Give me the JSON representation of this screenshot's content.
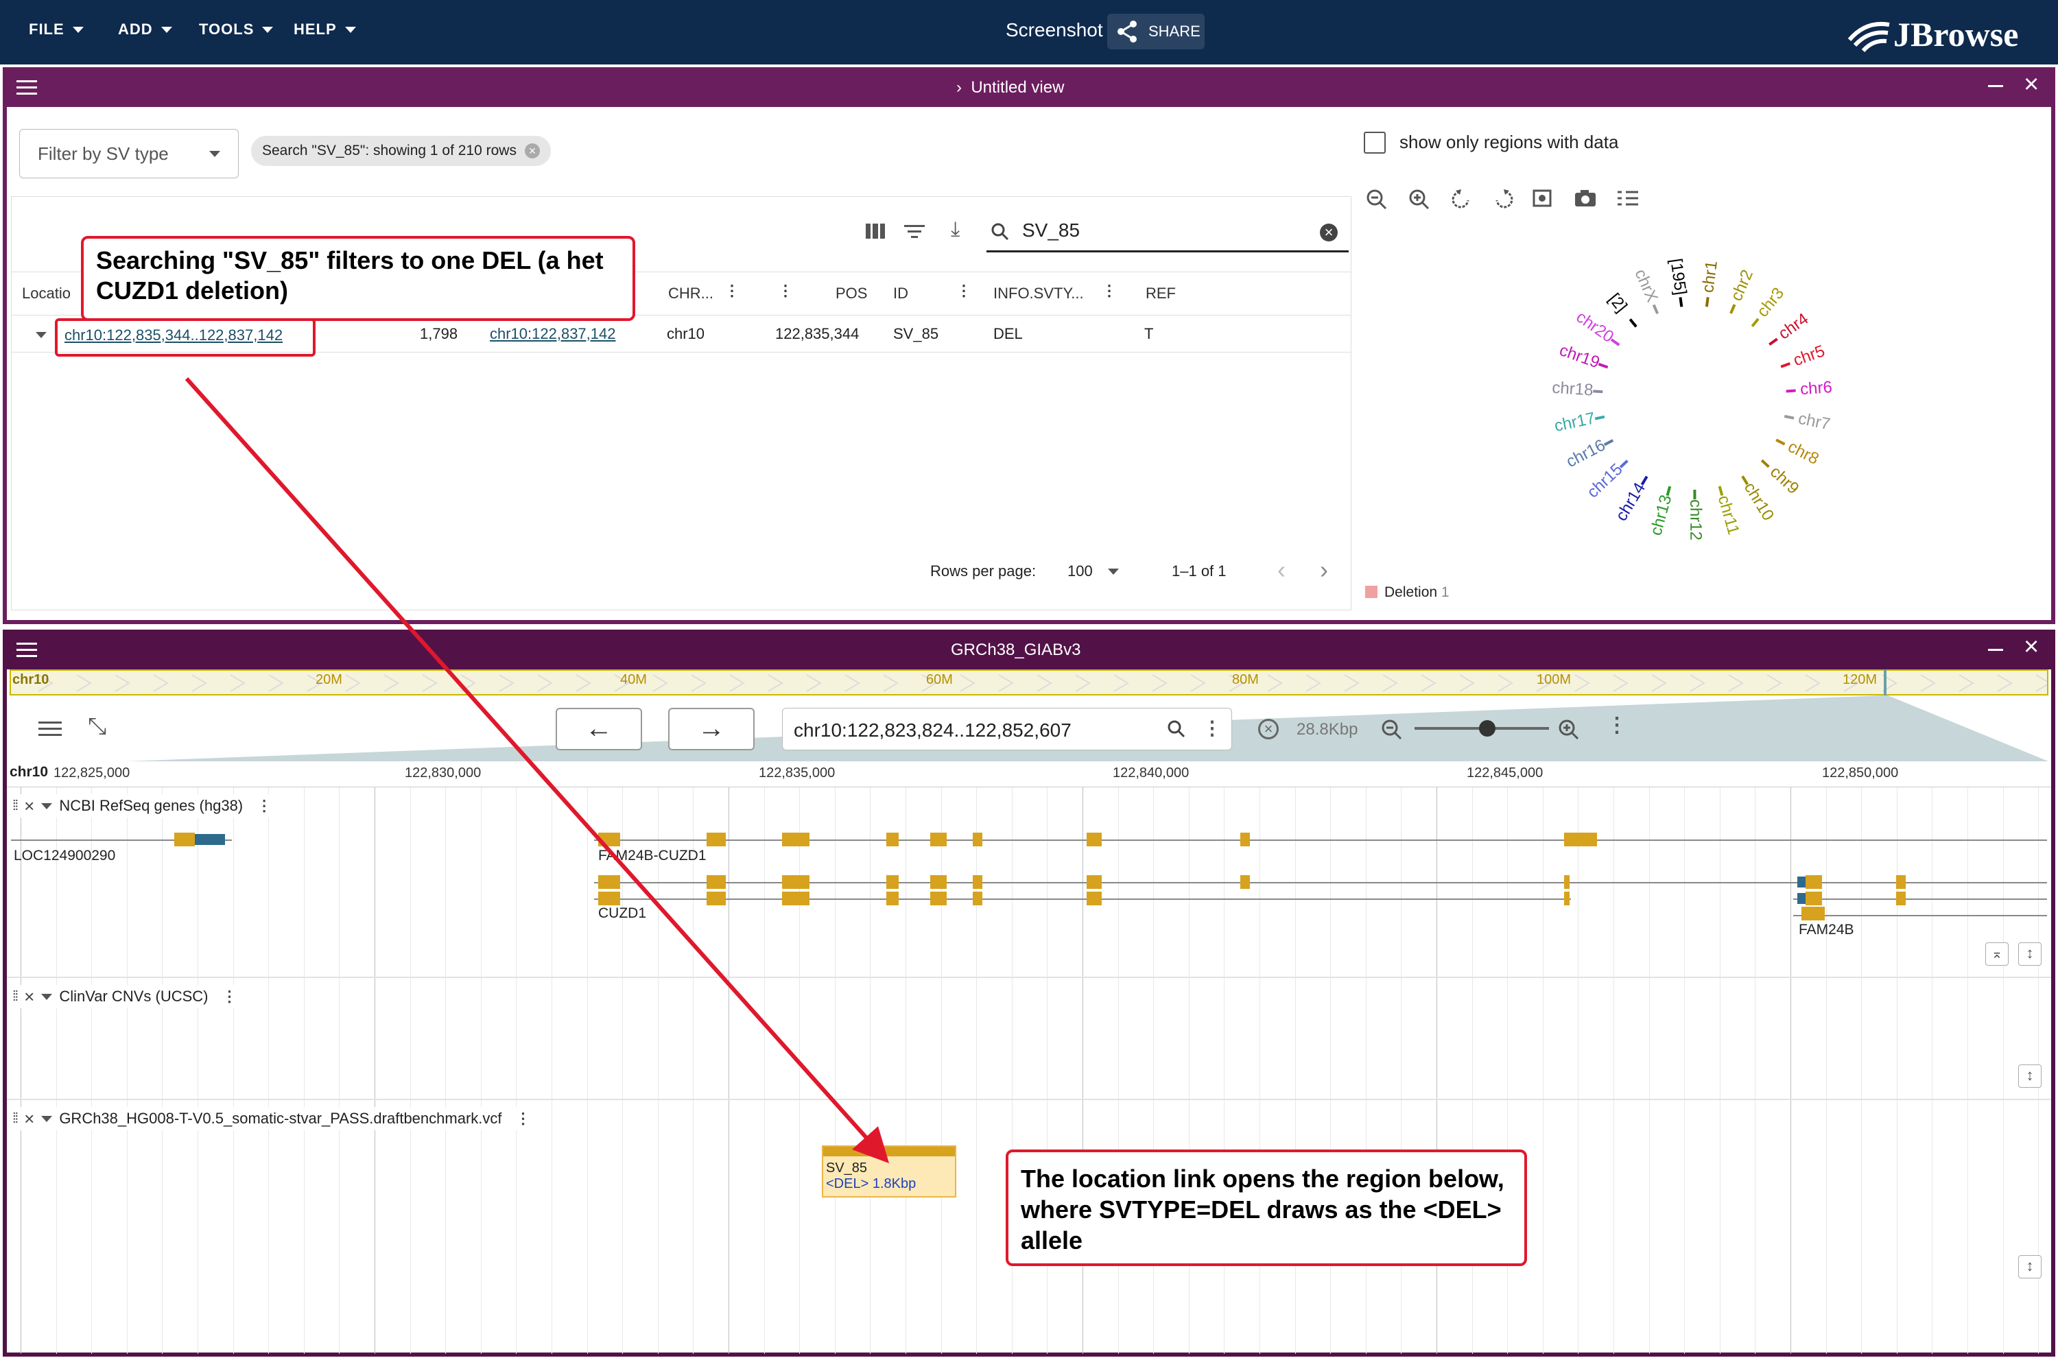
{
  "appbar": {
    "menus": [
      "FILE",
      "ADD",
      "TOOLS",
      "HELP"
    ],
    "screenshot_label": "Screenshot",
    "share_label": "SHARE",
    "brand": "JBrowse"
  },
  "top_view": {
    "title": "Untitled view",
    "filter_placeholder": "Filter by SV type",
    "search_chip": "Search \"SV_85\": showing 1 of 210 rows",
    "show_regions_label": "show only regions with data",
    "search_value": "SV_85",
    "columns": [
      "Locatio",
      "CHR...",
      "POS",
      "ID",
      "INFO.SVTY...",
      "REF"
    ],
    "row": {
      "location": "chr10:122,835,344..122,837,142",
      "length": "1,798",
      "end_link": "chr10:122,837,142",
      "chr": "chr10",
      "pos": "122,835,344",
      "id": "SV_85",
      "svtype": "DEL",
      "ref": "T"
    },
    "pagination": {
      "rows_per_page_label": "Rows per page:",
      "rows_per_page": "100",
      "range": "1–1 of 1"
    },
    "circular_labels": [
      "[195]",
      "chr1",
      "chr2",
      "chr3",
      "chr4",
      "chr5",
      "chr6",
      "chr7",
      "chr8",
      "chr9",
      "chr10",
      "chr11",
      "chr12",
      "chr13",
      "chr14",
      "chr15",
      "chr16",
      "chr17",
      "chr18",
      "chr19",
      "chr20",
      "[2]",
      "chrX"
    ],
    "legend_label": "Deletion",
    "legend_count": "1"
  },
  "bottom_view": {
    "title": "GRCh38_GIABv3",
    "overview_chrom": "chr10",
    "overview_ticks": [
      "20M",
      "40M",
      "60M",
      "80M",
      "100M",
      "120M"
    ],
    "locstring": "chr10:122,823,824..122,852,607",
    "span": "28.8Kbp",
    "ruler_chrom": "chr10",
    "ruler_ticks": [
      "122,825,000",
      "122,830,000",
      "122,835,000",
      "122,840,000",
      "122,845,000",
      "122,850,000"
    ],
    "tracks": {
      "refseq": "NCBI RefSeq genes (hg38)",
      "clinvar": "ClinVar CNVs (UCSC)",
      "vcf": "GRCh38_HG008-T-V0.5_somatic-stvar_PASS.draftbenchmark.vcf"
    },
    "genes": {
      "loc": "LOC124900290",
      "fam_cuzd1": "FAM24B-CUZD1",
      "cuzd1": "CUZD1",
      "fam24b": "FAM24B"
    },
    "feature": {
      "name": "SV_85",
      "allele": "<DEL> 1.8Kbp"
    }
  },
  "callouts": {
    "top": "Searching \"SV_85\" filters to one DEL (a het CUZD1 deletion)",
    "bottom": "The location link opens the region below, where SVTYPE=DEL draws as the <DEL> allele"
  },
  "colors": {
    "appbar": "#0e2a4d",
    "view_frame": "#6b1e5e",
    "exon": "#d7a21e",
    "utr": "#2e6a8c",
    "callout_red": "#e0182c",
    "deletion": "#f0a0a0"
  }
}
